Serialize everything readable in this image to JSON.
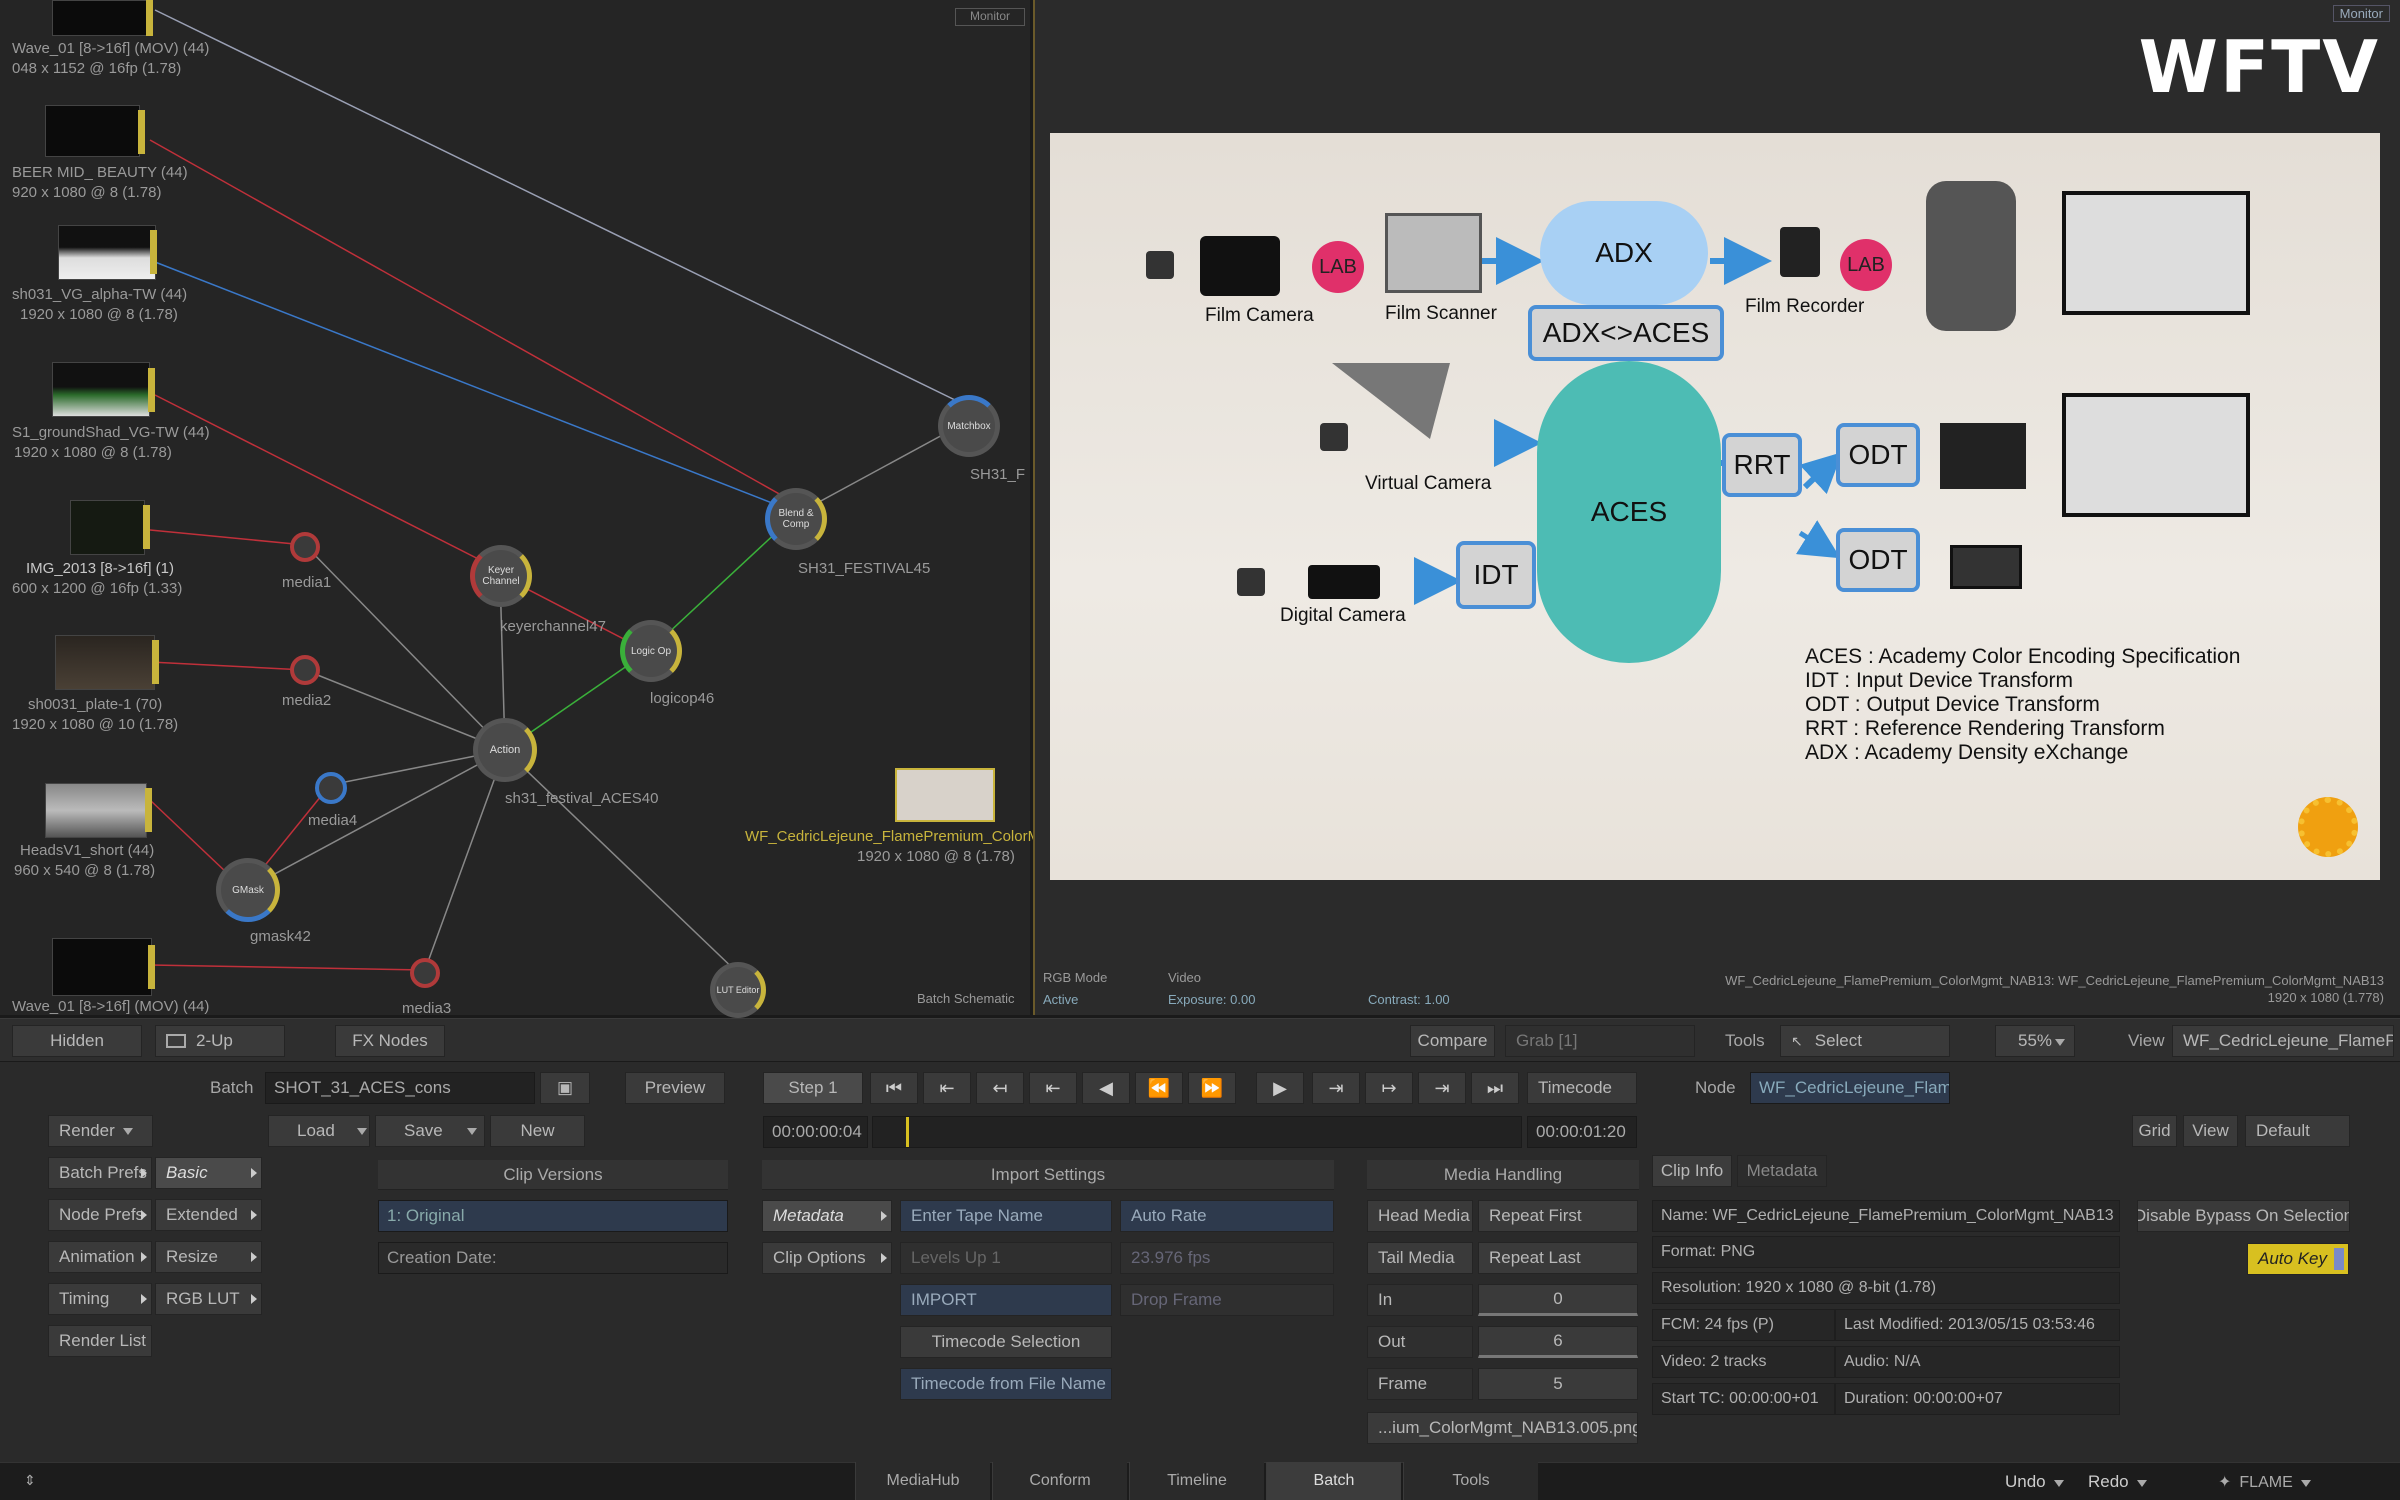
{
  "schematic": {
    "monitor_tag": "Monitor",
    "thumbs": [
      {
        "name": "Wave_01 [8->16f] (MOV) (44)",
        "res": "048 x 1152 @ 16fp (1.78)"
      },
      {
        "name": "BEER MID_ BEAUTY (44)",
        "res": "920 x 1080 @ 8 (1.78)"
      },
      {
        "name": "sh031_VG_alpha-TW (44)",
        "res": "1920 x 1080 @ 8 (1.78)"
      },
      {
        "name": "S1_groundShad_VG-TW (44)",
        "res": "1920 x 1080 @ 8 (1.78)"
      },
      {
        "name": "IMG_2013 [8->16f] (1)",
        "res": "600 x 1200 @ 16fp (1.33)"
      },
      {
        "name": "sh0031_plate-1 (70)",
        "res": "1920 x 1080 @ 10 (1.78)"
      },
      {
        "name": "HeadsV1_short (44)",
        "res": "960 x 540 @ 8 (1.78)"
      },
      {
        "name": "Wave_01 [8->16f] (MOV) (44)",
        "res": ""
      }
    ],
    "nodes": {
      "media1": "media1",
      "media2": "media2",
      "media4": "media4",
      "media3": "media3",
      "keyer": "Keyer Channel",
      "keyer_label": "keyerchannel47",
      "logic": "Logic Op",
      "logic_label": "logicop46",
      "action": "Action",
      "action_label": "sh31_festival_ACES40",
      "blend": "Blend & Comp",
      "blend_label": "SH31_FESTIVAL45",
      "gmask": "GMask",
      "gmask_label": "gmask42",
      "matchbox": "Matchbox",
      "matchbox_label": "SH31_F",
      "lut": "LUT Editor"
    },
    "clip_name": "WF_CedricLejeune_FlamePremium_ColorM",
    "clip_res": "1920 x 1080 @ 8 (1.78)",
    "schematic_label": "Batch Schematic"
  },
  "monitor": {
    "tag": "Monitor",
    "logo": "WFTV",
    "slide": {
      "film_camera": "Film Camera",
      "film_scanner": "Film Scanner",
      "film_recorder": "Film Recorder",
      "virtual_camera": "Virtual Camera",
      "digital_camera": "Digital Camera",
      "lab": "LAB",
      "adx": "ADX",
      "adx_aces": "ADX<>ACES",
      "aces": "ACES",
      "rrt": "RRT",
      "odt": "ODT",
      "idt": "IDT",
      "legend": [
        "ACES : Academy Color Encoding Specification",
        "IDT : Input Device Transform",
        "ODT : Output Device Transform",
        "RRT : Reference Rendering Transform",
        "ADX : Academy Density eXchange"
      ]
    },
    "info": {
      "rgb_mode": "RGB Mode",
      "active": "Active",
      "video": "Video",
      "exposure": "Exposure: 0.00",
      "contrast": "Contrast: 1.00",
      "clip_line": "WF_CedricLejeune_FlamePremium_ColorMgmt_NAB13: WF_CedricLejeune_FlamePremium_ColorMgmt_NAB13",
      "clip_res": "1920 x 1080 (1.778)"
    }
  },
  "toolbar": {
    "hidden": "Hidden",
    "two_up": "2-Up",
    "fx_nodes": "FX Nodes",
    "compare": "Compare",
    "grab": "Grab [1]",
    "tools": "Tools",
    "select": "Select",
    "zoom": "55%",
    "view": "View",
    "view_value": "WF_CedricLejeune_FlamePr"
  },
  "panel": {
    "batch_label": "Batch",
    "batch_name": "SHOT_31_ACES_cons",
    "preview": "Preview",
    "render": "Render",
    "load": "Load",
    "save": "Save",
    "new": "New",
    "left_buttons": [
      "Batch Prefs",
      "Node Prefs",
      "Animation",
      "Timing",
      "Render List"
    ],
    "mid_buttons": [
      "Basic",
      "Extended",
      "Resize",
      "RGB LUT"
    ],
    "clip_versions": "Clip Versions",
    "version": "1: Original",
    "creation_date": "Creation Date:",
    "step": "Step 1",
    "timecode_label": "Timecode",
    "tc_current": "00:00:00:04",
    "tc_end": "00:00:01:20",
    "node_label": "Node",
    "node_value": "WF_CedricLejeune_FlamePremi",
    "grid": "Grid",
    "view": "View",
    "default": "Default",
    "import_settings": "Import Settings",
    "metadata": "Metadata",
    "clip_options": "Clip Options",
    "enter_tape": "Enter Tape Name",
    "levels": "Levels Up 1",
    "import": "IMPORT",
    "timecode_selection": "Timecode Selection",
    "timecode_from_file": "Timecode from File Name",
    "auto_rate": "Auto Rate",
    "fps": "23.976 fps",
    "drop_frame": "Drop Frame",
    "media_handling": "Media Handling",
    "head_media": "Head Media",
    "repeat_first": "Repeat First",
    "tail_media": "Tail Media",
    "repeat_last": "Repeat Last",
    "in": "In",
    "in_val": "0",
    "out": "Out",
    "out_val": "6",
    "frame": "Frame",
    "frame_val": "5",
    "filename": "...ium_ColorMgmt_NAB13.005.png",
    "clip_info_tab": "Clip Info",
    "metadata_tab": "Metadata",
    "info_name": "Name: WF_CedricLejeune_FlamePremium_ColorMgmt_NAB13",
    "info_format": "Format: PNG",
    "info_resolution": "Resolution: 1920 x 1080 @ 8-bit (1.78)",
    "info_fcm": "FCM: 24 fps (P)",
    "info_modified": "Last Modified: 2013/05/15 03:53:46",
    "info_video": "Video: 2 tracks",
    "info_audio": "Audio: N/A",
    "info_start": "Start TC: 00:00:00+01",
    "info_duration": "Duration: 00:00:00+07",
    "disable_bypass": "Disable Bypass On Selection",
    "auto_key": "Auto Key",
    "timeline_progress": 0.05
  },
  "bottom": {
    "tabs": [
      "MediaHub",
      "Conform",
      "Timeline",
      "Batch",
      "Tools"
    ],
    "active": "Batch",
    "undo": "Undo",
    "redo": "Redo",
    "app": "FLAME"
  },
  "colors": {
    "accent_yellow": "#c8b43c",
    "link_red": "#c0303a",
    "link_blue": "#3a78c8",
    "link_green": "#3ab03a",
    "aces_teal": "#4dbcb4",
    "adx_blue": "#a8d0f4",
    "lab_pink": "#e0306a",
    "auto_key": "#d8c020"
  }
}
